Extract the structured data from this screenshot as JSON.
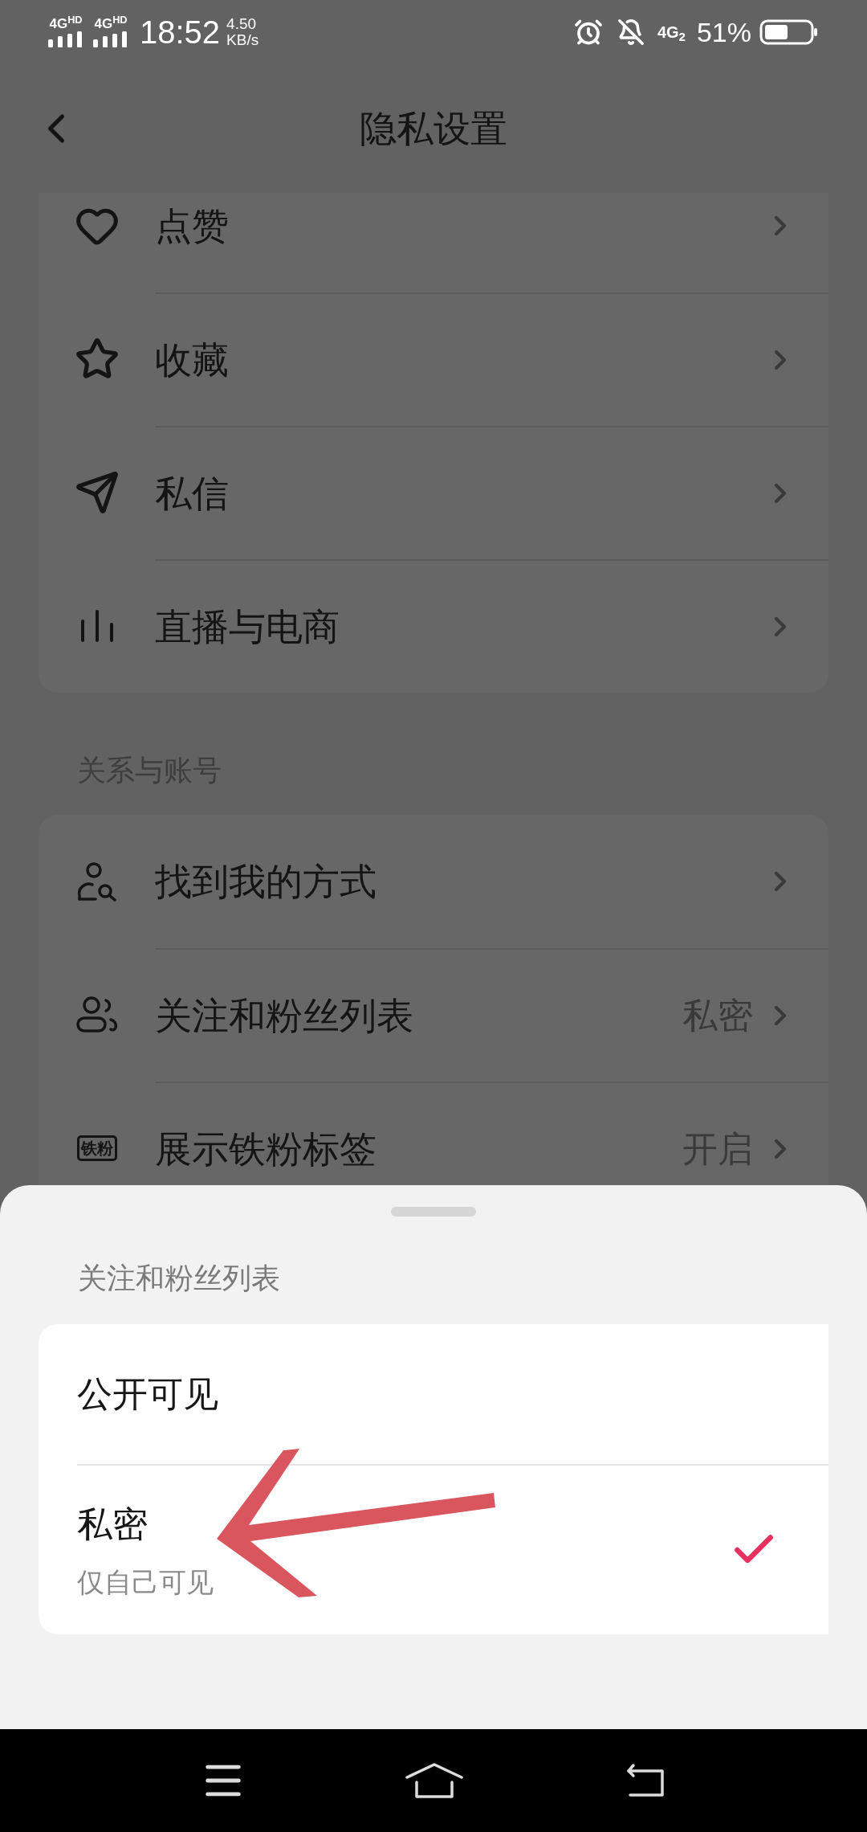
{
  "status_bar": {
    "networks": [
      "4G$^{HD}$",
      "4G$^{HD}$"
    ],
    "time": "18:52",
    "speed": "4.50",
    "speed_unit": "KB/s",
    "mobile_data": "4G$_{2}$",
    "battery": "51%"
  },
  "header": {
    "title": "隐私设置"
  },
  "sections": [
    {
      "items": [
        {
          "kind": "heart",
          "label": "点赞"
        },
        {
          "kind": "star",
          "label": "收藏"
        },
        {
          "kind": "send",
          "label": "私信"
        },
        {
          "kind": "bars",
          "label": "直播与电商"
        }
      ]
    },
    {
      "title": "关系与账号",
      "items": [
        {
          "kind": "user-search",
          "label": "找到我的方式"
        },
        {
          "kind": "users",
          "label": "关注和粉丝列表",
          "value": "私密"
        },
        {
          "kind": "badge",
          "label": "展示铁粉标签",
          "value": "开启",
          "badge": "铁粉"
        }
      ]
    }
  ],
  "sheet": {
    "title": "关注和粉丝列表",
    "options": [
      {
        "label": "公开可见",
        "selected": false
      },
      {
        "label": "私密",
        "subtitle": "仅自己可见",
        "selected": true
      }
    ]
  },
  "annotation": {
    "kind": "arrow"
  }
}
